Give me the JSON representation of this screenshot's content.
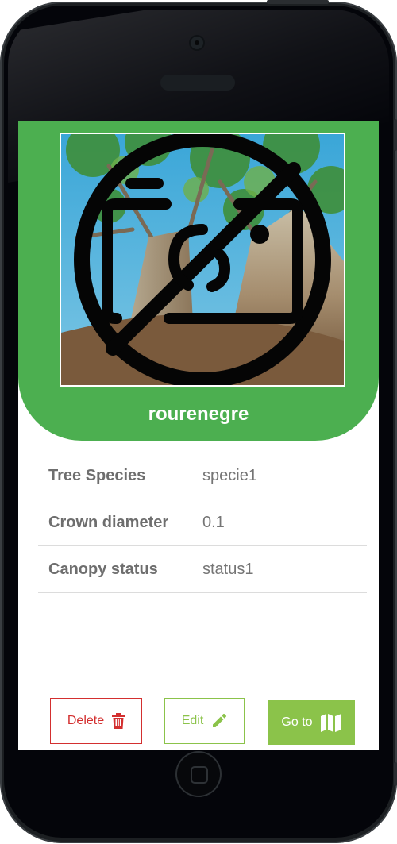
{
  "tree": {
    "name": "rourenegre",
    "photo_icon": "no-photo-icon"
  },
  "details": [
    {
      "label": "Tree Species",
      "value": "specie1"
    },
    {
      "label": "Crown diameter",
      "value": "0.1"
    },
    {
      "label": "Canopy status",
      "value": "status1"
    }
  ],
  "actions": {
    "delete_label": "Delete",
    "edit_label": "Edit",
    "goto_label": "Go to"
  },
  "icons": {
    "delete": "trash-icon",
    "edit": "pencil-icon",
    "goto": "map-icon"
  },
  "colors": {
    "header_green": "#4caf50",
    "accent_green": "#8bc34a",
    "danger_red": "#d32f2f"
  }
}
